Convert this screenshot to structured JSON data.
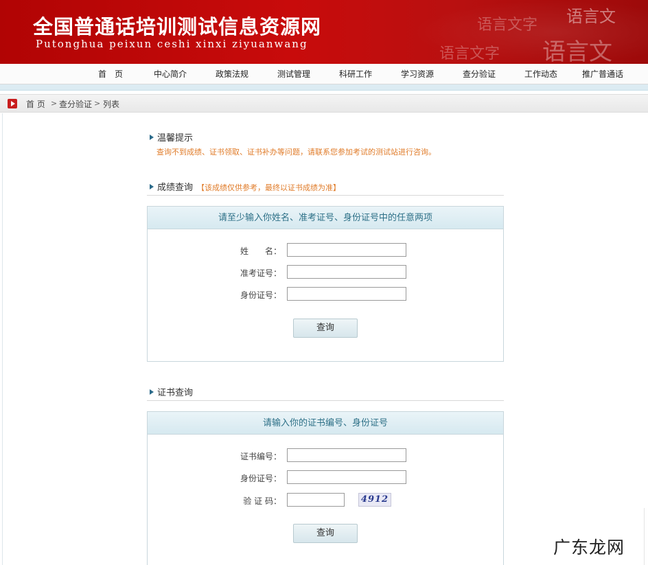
{
  "header": {
    "title": "全国普通话培训测试信息资源网",
    "subtitle": "Putonghua peixun ceshi xinxi ziyuanwang",
    "decor_text": [
      "语言文字",
      "语言文",
      "语言文字",
      "语言文"
    ]
  },
  "nav": {
    "items": [
      "首　页",
      "中心简介",
      "政策法规",
      "测试管理",
      "科研工作",
      "学习资源",
      "查分验证",
      "工作动态",
      "推广普通话"
    ]
  },
  "breadcrumb": {
    "home": "首 页",
    "section": "查分验证",
    "current": "列表",
    "sep": ">"
  },
  "tips": {
    "heading": "温馨提示",
    "text": "查询不到成绩、证书领取、证书补办等问题，请联系您参加考试的测试站进行咨询。"
  },
  "score_query": {
    "heading": "成绩查询",
    "hint": "【该成绩仅供参考，最终以证书成绩为准】",
    "panel_title": "请至少输入你姓名、准考证号、身份证号中的任意两项",
    "labels": {
      "name": "姓　　名：",
      "exam_no": "准考证号：",
      "id_no": "身份证号："
    },
    "values": {
      "name": "",
      "exam_no": "",
      "id_no": ""
    },
    "button": "查询"
  },
  "cert_query": {
    "heading": "证书查询",
    "panel_title": "请输入你的证书编号、身份证号",
    "labels": {
      "cert_no": "证书编号：",
      "id_no": "身份证号：",
      "captcha": "验 证 码："
    },
    "values": {
      "cert_no": "",
      "id_no": "",
      "captcha": ""
    },
    "captcha_image_text": "4912",
    "button": "查询"
  },
  "watermark": "广东龙网",
  "colors": {
    "banner_red": "#c80b0b",
    "link_blue": "#2d7087",
    "hint_orange": "#e07c2a"
  }
}
